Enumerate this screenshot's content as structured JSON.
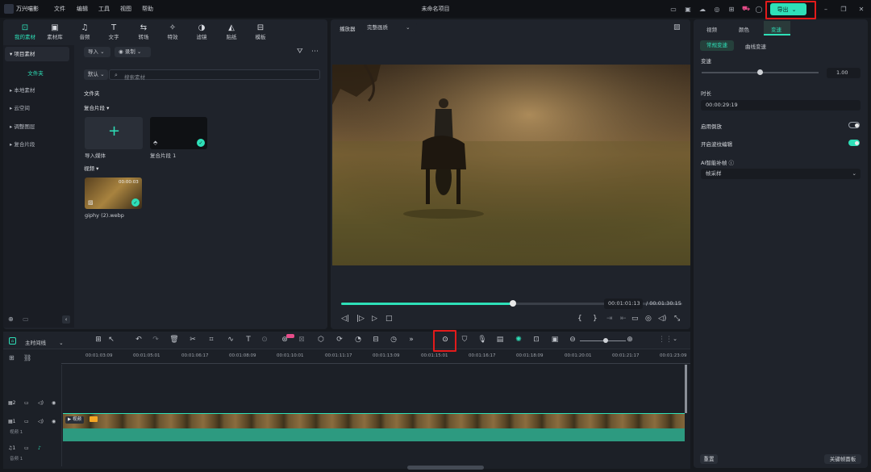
{
  "app": {
    "name": "万兴喵影",
    "title": "未命名项目"
  },
  "menu": [
    "文件",
    "编辑",
    "工具",
    "视图",
    "帮助"
  ],
  "export": {
    "label": "导出"
  },
  "media_tabs": [
    {
      "label": "我的素材",
      "icon": "media-icon"
    },
    {
      "label": "素材库",
      "icon": "stock-icon"
    },
    {
      "label": "音频",
      "icon": "music-icon"
    },
    {
      "label": "文字",
      "icon": "text-icon"
    },
    {
      "label": "转场",
      "icon": "transition-icon"
    },
    {
      "label": "特效",
      "icon": "effects-icon"
    },
    {
      "label": "滤镜",
      "icon": "filter-icon"
    },
    {
      "label": "贴纸",
      "icon": "sticker-icon"
    },
    {
      "label": "模板",
      "icon": "template-icon"
    }
  ],
  "left_nav": {
    "project": "项目素材",
    "folder": "文件夹",
    "items": [
      "本地素材",
      "云空间",
      "调整图层",
      "复合片段"
    ]
  },
  "toolbar": {
    "import": "导入",
    "record": "录制",
    "sort": "默认",
    "search_placeholder": "搜索素材"
  },
  "library": {
    "folder_title": "文件夹",
    "compound_title": "复合片段",
    "import_label": "导入媒体",
    "compound_item": "复合片段 1",
    "video_title": "视频",
    "video_item": "giphy (2).webp",
    "video_duration": "00:00:03"
  },
  "preview": {
    "player_label": "播放器",
    "quality": "完整画质",
    "current_time": "00:01:01:13",
    "total_time": "/ 00:01:30:15",
    "progress": 0.5
  },
  "right_panel": {
    "tabs": [
      "视频",
      "颜色",
      "变速"
    ],
    "subtabs": [
      "常规变速",
      "曲线变速"
    ],
    "speed_label": "变速",
    "speed_value": "1.00",
    "duration_label": "时长",
    "duration_value": "00:00:29:19",
    "reverse_label": "启用倒放",
    "ripple_label": "开启波纹编辑",
    "ai_label": "AI智能补帧",
    "ai_value": "帧采样",
    "reset": "重置",
    "keyframe_panel": "关键帧面板"
  },
  "timeline": {
    "main_label": "主时间线",
    "ruler": [
      "00:01:03:09",
      "00:01:05:01",
      "00:01:06:17",
      "00:01:08:09",
      "00:01:10:01",
      "00:01:11:17",
      "00:01:13:09",
      "00:01:15:01",
      "00:01:16:17",
      "00:01:18:09",
      "00:01:20:01",
      "00:01:21:17",
      "00:01:23:09"
    ],
    "track_video_2": "2",
    "track_video_1": "1",
    "video_track_name": "视频 1",
    "track_audio_1": "1",
    "audio_track_name": "音频 1",
    "clip_label": "视频"
  },
  "colors": {
    "accent": "#2ee0b8",
    "highlight": "#e21b1b"
  }
}
